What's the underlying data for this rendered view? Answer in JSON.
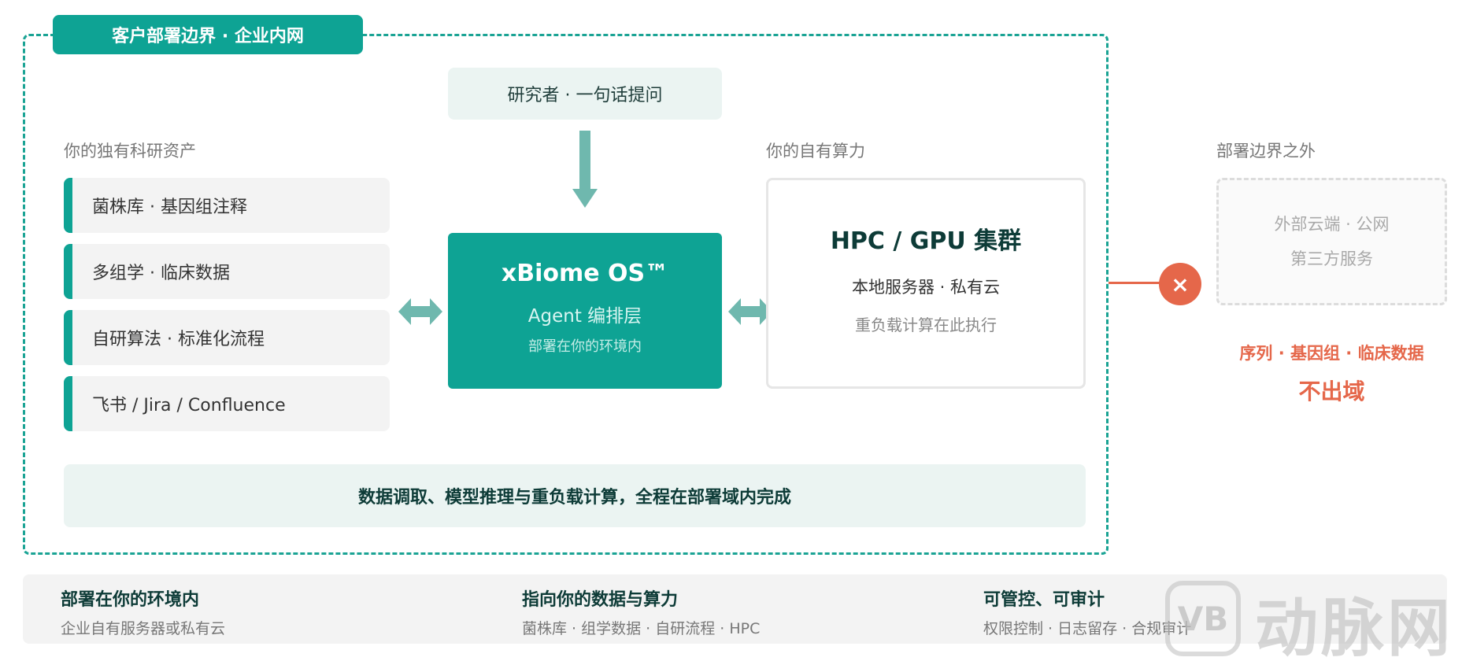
{
  "boundary": {
    "tag": "客户部署边界 · 企业内网"
  },
  "researcher": {
    "label": "研究者 · 一句话提问"
  },
  "assets": {
    "heading": "你的独有科研资产",
    "items": [
      "菌株库 · 基因组注释",
      "多组学 · 临床数据",
      "自研算法 · 标准化流程",
      "飞书 / Jira / Confluence"
    ]
  },
  "core": {
    "title": "xBiome OS™",
    "subtitle": "Agent 编排层",
    "note": "部署在你的环境内"
  },
  "compute": {
    "heading": "你的自有算力",
    "title": "HPC / GPU 集群",
    "subtitle": "本地服务器 · 私有云",
    "note": "重负载计算在此执行"
  },
  "summary": "数据调取、模型推理与重负载计算，全程在部署域内完成",
  "outside": {
    "heading": "部署边界之外",
    "line1": "外部云端 · 公网",
    "line2": "第三方服务",
    "block_icon": "×",
    "warning_line1": "序列 · 基因组 · 临床数据",
    "warning_line2": "不出域"
  },
  "footer": [
    {
      "title": "部署在你的环境内",
      "desc": "企业自有服务器或私有云"
    },
    {
      "title": "指向你的数据与算力",
      "desc": "菌株库 · 组学数据 · 自研流程 · HPC"
    },
    {
      "title": "可管控、可审计",
      "desc": "权限控制 · 日志留存 · 合规审计"
    }
  ],
  "watermark": {
    "logo": "VB",
    "text": "动脉网"
  },
  "colors": {
    "primary": "#0ea394",
    "arrow": "#6fb8ae",
    "danger": "#e5674a",
    "light_panel": "#ebf4f2",
    "dark_text": "#0d3b37"
  }
}
